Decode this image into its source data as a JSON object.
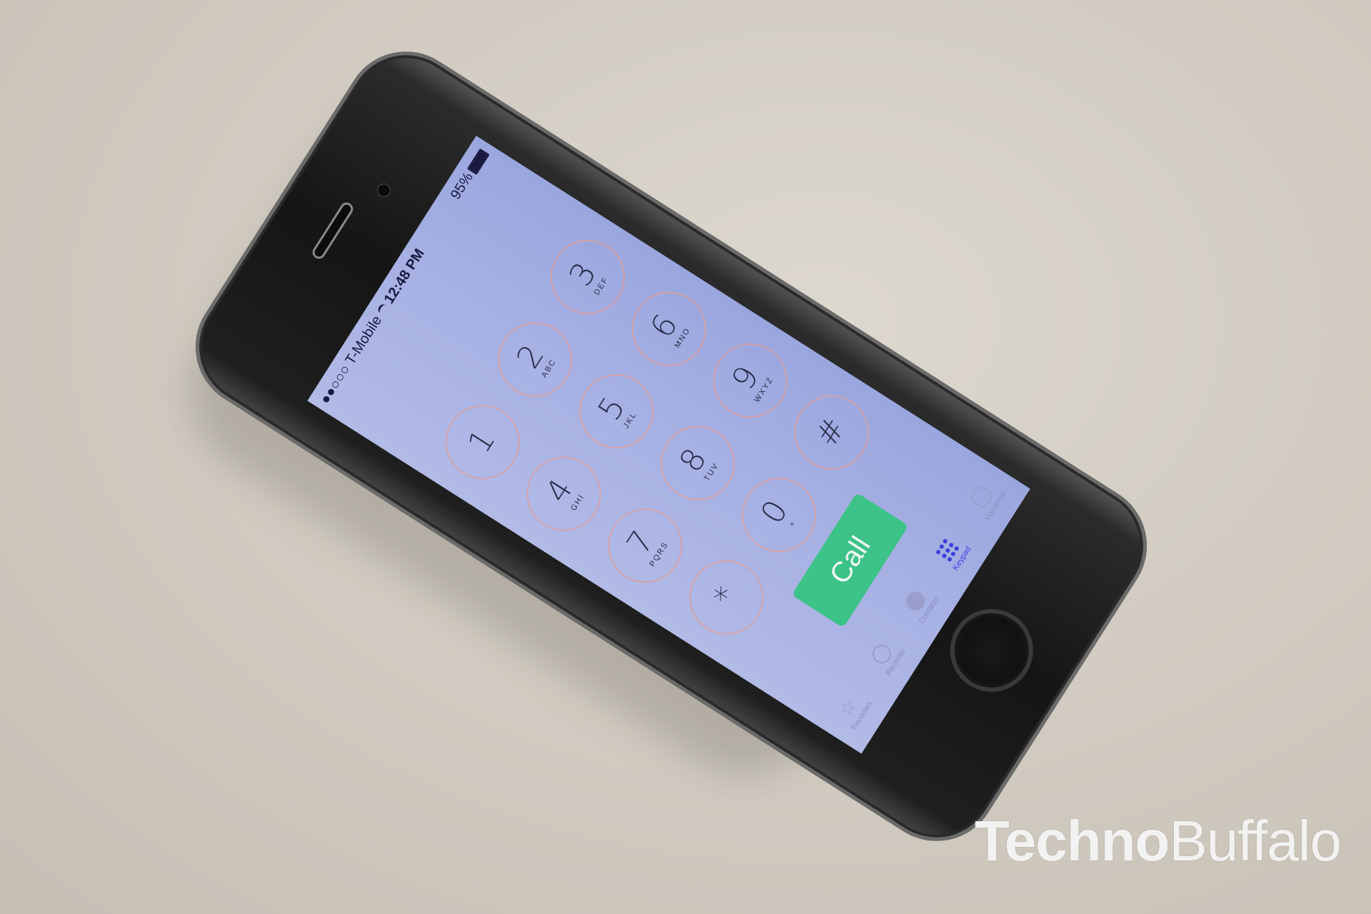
{
  "status_bar": {
    "carrier": "●●○○○ T-Mobile",
    "time": "12:48 PM",
    "battery": "95%"
  },
  "keypad": [
    {
      "digit": "1",
      "letters": ""
    },
    {
      "digit": "2",
      "letters": "ABC"
    },
    {
      "digit": "3",
      "letters": "DEF"
    },
    {
      "digit": "4",
      "letters": "GHI"
    },
    {
      "digit": "5",
      "letters": "JKL"
    },
    {
      "digit": "6",
      "letters": "MNO"
    },
    {
      "digit": "7",
      "letters": "PQRS"
    },
    {
      "digit": "8",
      "letters": "TUV"
    },
    {
      "digit": "9",
      "letters": "WXYZ"
    },
    {
      "digit": "*",
      "letters": ""
    },
    {
      "digit": "0",
      "letters": "+"
    },
    {
      "digit": "#",
      "letters": ""
    }
  ],
  "call_label": "Call",
  "tabs": [
    {
      "label": "Favorites",
      "icon": "star-icon"
    },
    {
      "label": "Recents",
      "icon": "clock-icon"
    },
    {
      "label": "Contacts",
      "icon": "person-icon"
    },
    {
      "label": "Keypad",
      "icon": "keypad-icon"
    },
    {
      "label": "Voicemail",
      "icon": "voicemail-icon"
    }
  ],
  "watermark": {
    "bold": "Techno",
    "light": "Buffalo"
  },
  "colors": {
    "call": "#3dc287",
    "active_tab": "#3a3fe0",
    "screen": "#a8b2e4"
  }
}
